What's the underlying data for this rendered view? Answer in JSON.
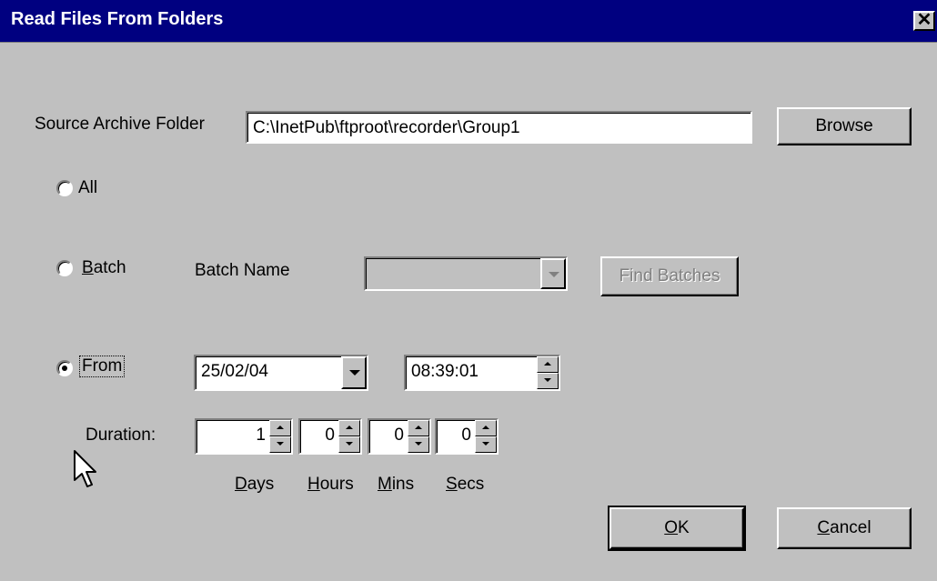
{
  "window": {
    "title": "Read Files From Folders",
    "close_glyph": "✕"
  },
  "source": {
    "label": "Source Archive Folder",
    "value": "C:\\InetPub\\ftproot\\recorder\\Group1",
    "browse_label": "Browse"
  },
  "options": {
    "all_label": "All",
    "batch_label_underlined": "B",
    "batch_label_rest": "atch",
    "from_label": "From",
    "selected": "from"
  },
  "batch": {
    "name_label": "Batch Name",
    "name_value": "",
    "find_label": "Find Batches"
  },
  "from": {
    "date": "25/02/04",
    "time": "08:39:01"
  },
  "duration": {
    "label": "Duration:",
    "days": "1",
    "hours": "0",
    "mins": "0",
    "secs": "0",
    "days_u": "D",
    "days_r": "ays",
    "hours_u": "H",
    "hours_r": "ours",
    "mins_u": "M",
    "mins_r": "ins",
    "secs_u": "S",
    "secs_r": "ecs"
  },
  "actions": {
    "ok_u": "O",
    "ok_r": "K",
    "cancel_u": "C",
    "cancel_r": "ancel"
  }
}
